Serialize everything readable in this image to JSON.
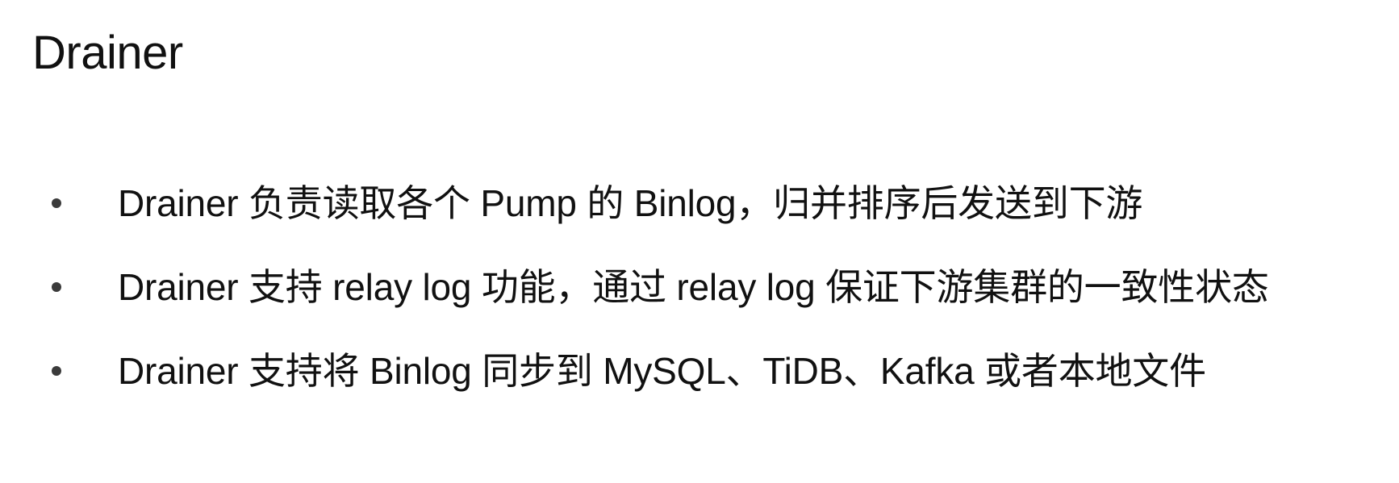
{
  "slide": {
    "title": "Drainer",
    "bullets": [
      "Drainer 负责读取各个 Pump 的 Binlog，归并排序后发送到下游",
      "Drainer 支持 relay log 功能，通过 relay log 保证下游集群的一致性状态",
      "Drainer 支持将 Binlog 同步到 MySQL、TiDB、Kafka 或者本地文件"
    ]
  }
}
